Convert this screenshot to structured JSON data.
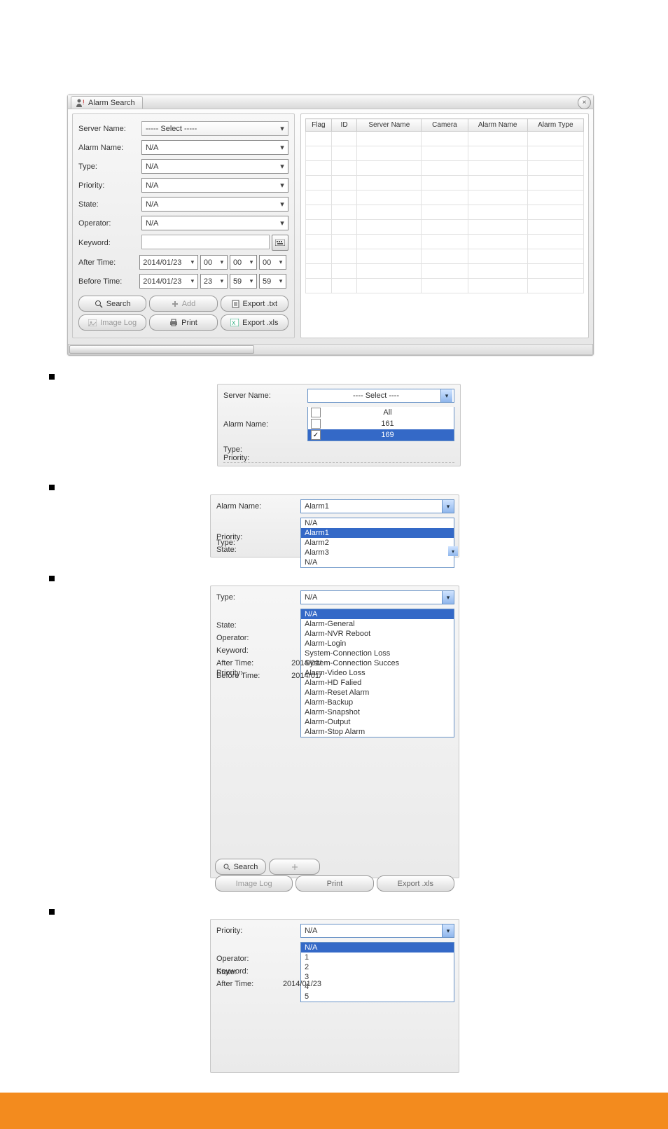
{
  "window": {
    "title": "Alarm Search",
    "close": "×"
  },
  "form": {
    "serverName": {
      "label": "Server Name:",
      "value": "-----   Select   -----"
    },
    "alarmName": {
      "label": "Alarm Name:",
      "value": "N/A"
    },
    "type": {
      "label": "Type:",
      "value": "N/A"
    },
    "priority": {
      "label": "Priority:",
      "value": "N/A"
    },
    "state": {
      "label": "State:",
      "value": "N/A"
    },
    "operator": {
      "label": "Operator:",
      "value": "N/A"
    },
    "keyword": {
      "label": "Keyword:"
    },
    "afterTime": {
      "label": "After Time:",
      "date": "2014/01/23",
      "h": "00",
      "m": "00",
      "s": "00"
    },
    "beforeTime": {
      "label": "Before Time:",
      "date": "2014/01/23",
      "h": "23",
      "m": "59",
      "s": "59"
    }
  },
  "buttons": {
    "search": "Search",
    "add": "Add",
    "exportTxt": "Export .txt",
    "imageLog": "Image Log",
    "print": "Print",
    "exportXls": "Export .xls"
  },
  "gridCols": {
    "flag": "Flag",
    "id": "ID",
    "serverName": "Server Name",
    "camera": "Camera",
    "alarmName": "Alarm Name",
    "alarmType": "Alarm Type"
  },
  "example1": {
    "serverName": {
      "label": "Server Name:",
      "display": "---- Select ----"
    },
    "alarmName": {
      "label": "Alarm Name:"
    },
    "type": {
      "label": "Type:"
    },
    "priority": {
      "label": "Priority:"
    },
    "options": {
      "all": "All",
      "o161": "161",
      "o169": "169"
    }
  },
  "example2": {
    "alarmName": {
      "label": "Alarm Name:",
      "display": "Alarm1"
    },
    "type": {
      "label": "Type:"
    },
    "priority": {
      "label": "Priority:"
    },
    "state": {
      "label": "State:"
    },
    "options": {
      "na": "N/A",
      "a1": "Alarm1",
      "a2": "Alarm2",
      "a3": "Alarm3",
      "naB": "N/A"
    }
  },
  "example3": {
    "type": {
      "label": "Type:",
      "display": "N/A"
    },
    "priority": {
      "label": "Priority:"
    },
    "state": {
      "label": "State:"
    },
    "operator": {
      "label": "Operator:"
    },
    "keyword": {
      "label": "Keyword:"
    },
    "afterTime": {
      "label": "After Time:",
      "date": "2014/01/"
    },
    "beforeTime": {
      "label": "Before Time:",
      "date": "2014/01/"
    },
    "search": "Search",
    "imageLog": "Image Log",
    "print": "Print",
    "exportXls": "Export .xls",
    "options": {
      "na": "N/A",
      "o1": "Alarm-General",
      "o2": "Alarm-NVR Reboot",
      "o3": "Alarm-Login",
      "o4": "System-Connection Loss",
      "o5": "System-Connection Succes",
      "o6": "Alarm-Video Loss",
      "o7": "Alarm-HD Falied",
      "o8": "Alarm-Reset Alarm",
      "o9": "Alarm-Backup",
      "o10": "Alarm-Snapshot",
      "o11": "Alarm-Output",
      "o12": "Alarm-Stop Alarm"
    }
  },
  "example4": {
    "priority": {
      "label": "Priority:",
      "display": "N/A"
    },
    "state": {
      "label": "State:"
    },
    "operator": {
      "label": "Operator:"
    },
    "keyword": {
      "label": "Keyword:"
    },
    "afterTime": {
      "label": "After Time:",
      "date": "2014/01/23"
    },
    "options": {
      "na": "N/A",
      "p1": "1",
      "p2": "2",
      "p3": "3",
      "p4": "4",
      "p5": "5"
    }
  }
}
